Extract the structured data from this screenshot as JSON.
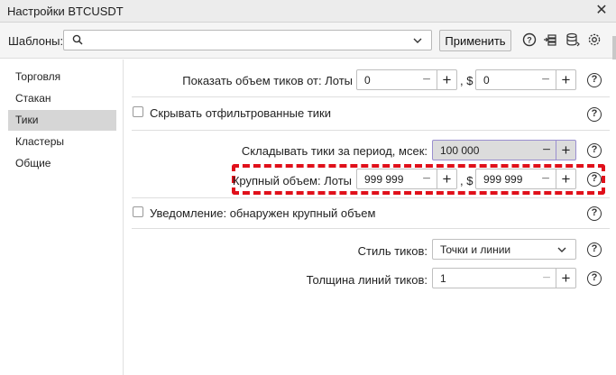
{
  "window": {
    "title": "Настройки BTCUSDT",
    "close_icon": "close-icon"
  },
  "toolbar": {
    "templates_label": "Шаблоны:",
    "search_value": "",
    "apply_label": "Применить",
    "icons": [
      "help-icon",
      "import-icon",
      "database-icon",
      "settings-icon"
    ]
  },
  "sidebar": {
    "items": [
      {
        "label": "Торговля",
        "active": false
      },
      {
        "label": "Стакан",
        "active": false
      },
      {
        "label": "Тики",
        "active": true
      },
      {
        "label": "Кластеры",
        "active": false
      },
      {
        "label": "Общие",
        "active": false
      }
    ]
  },
  "settings": {
    "show_volume": {
      "label": "Показать объем тиков от: Лоты",
      "lots_value": "0",
      "sep": ", $",
      "usd_value": "0"
    },
    "hide_filtered": {
      "label": "Скрывать отфильтрованные тики",
      "checked": false
    },
    "aggregate": {
      "label": "Складывать тики за период, мсек:",
      "value": "100 000"
    },
    "large_volume": {
      "label": "Крупный объем: Лоты",
      "lots_value": "999 999",
      "sep": ", $",
      "usd_value": "999 999"
    },
    "notify": {
      "label": "Уведомление: обнаружен крупный объем",
      "checked": false
    },
    "tick_style": {
      "label": "Стиль тиков:",
      "value": "Точки и линии"
    },
    "line_width": {
      "label": "Толщина линий тиков:",
      "value": "1"
    }
  },
  "symbols": {
    "minus": "−",
    "plus": "+",
    "help": "?"
  },
  "colors": {
    "highlight_dash": "#e0101a",
    "active_sidebar": "#d6d6d6"
  }
}
